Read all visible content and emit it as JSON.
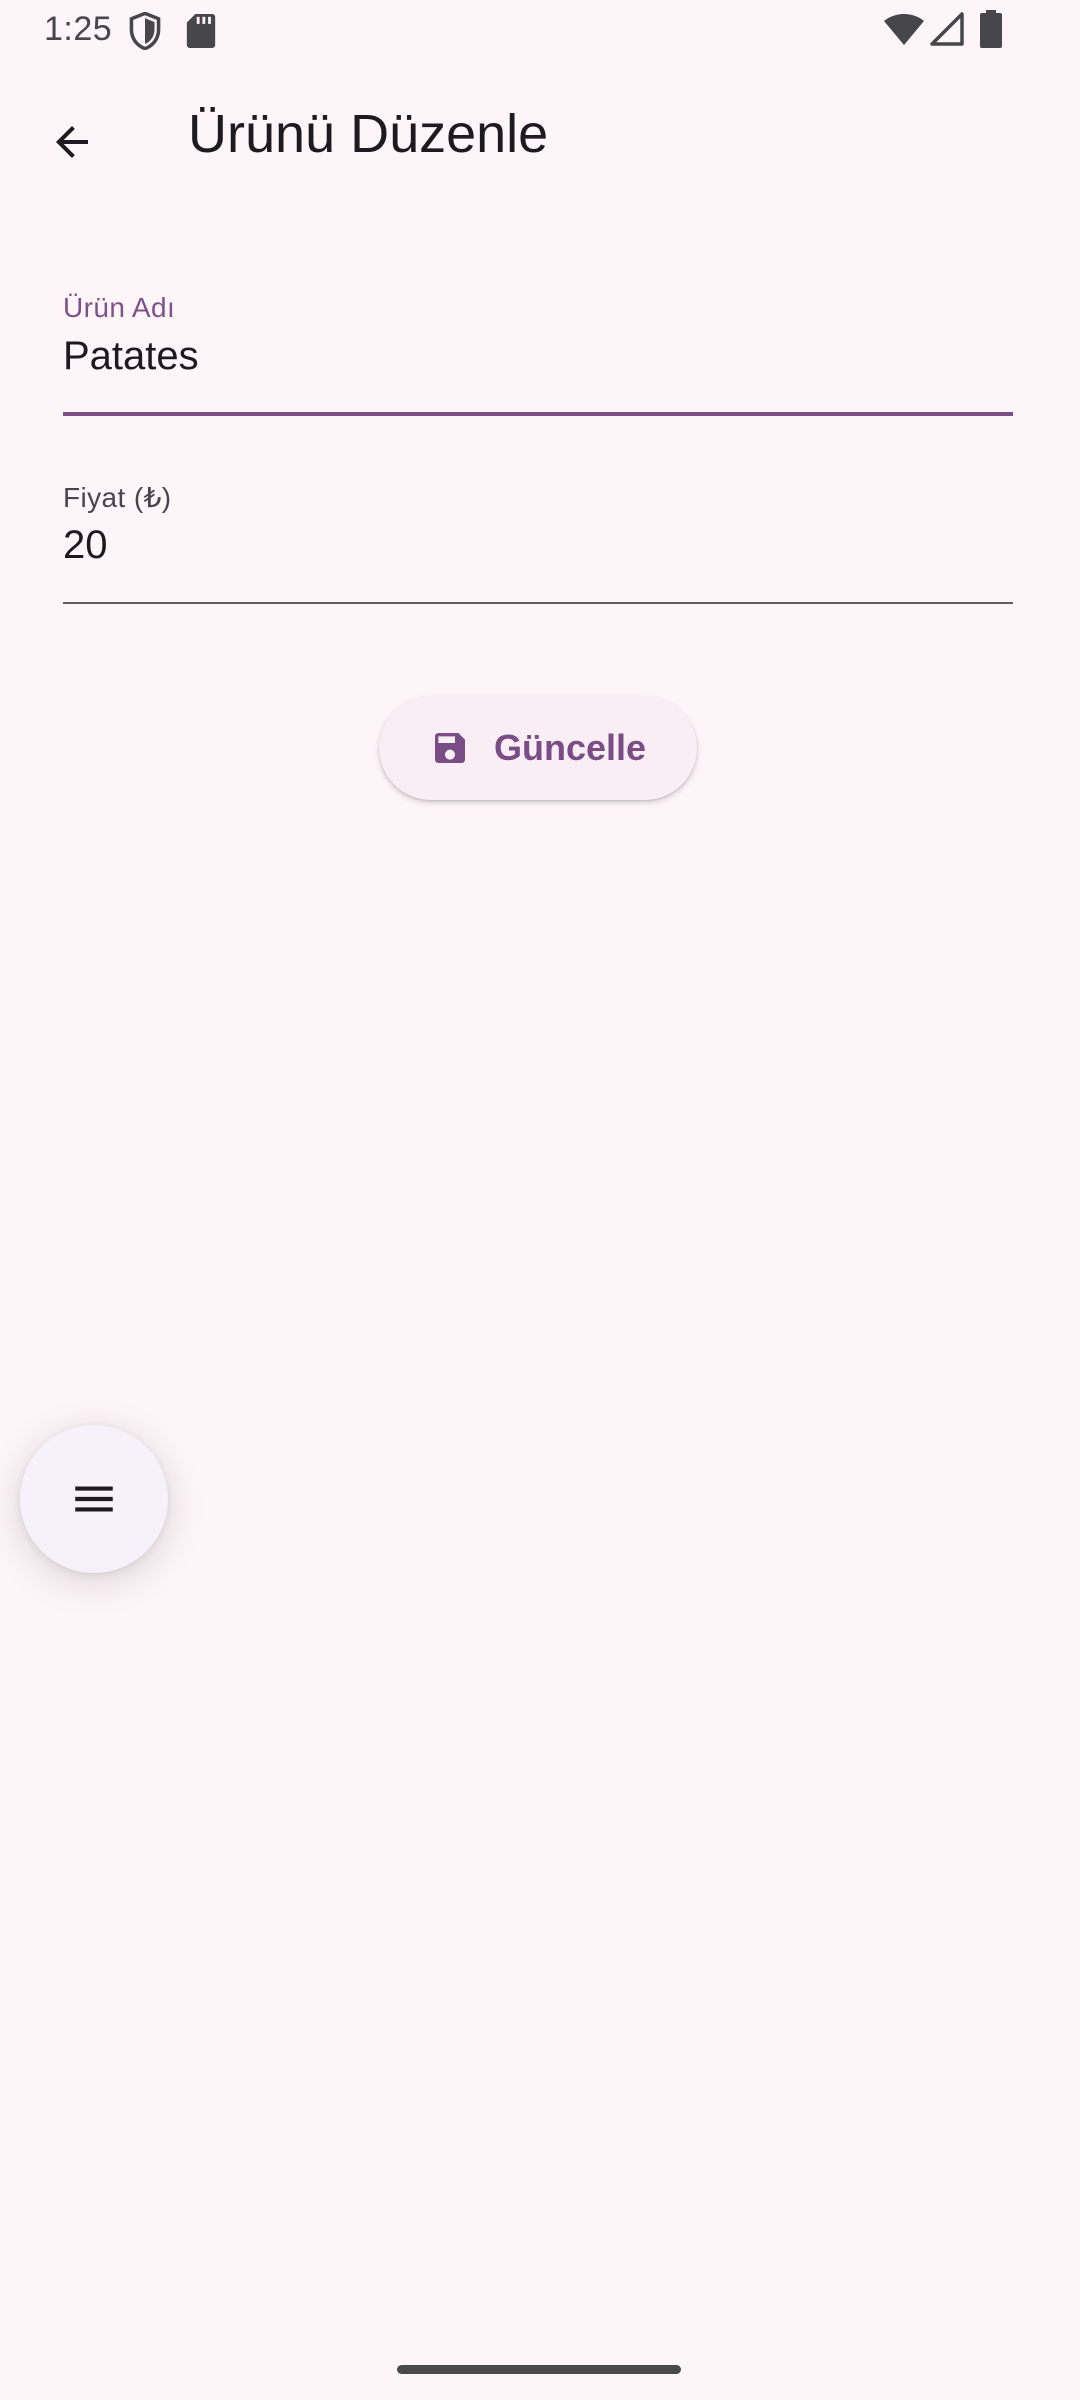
{
  "status_bar": {
    "time": "1:25",
    "left_icons": [
      "shield-icon",
      "sd-card-icon"
    ],
    "right_icons": [
      "wifi-icon",
      "cellular-signal-icon",
      "battery-icon"
    ]
  },
  "app_bar": {
    "back_icon": "arrow-back-icon",
    "title": "Ürünü Düzenle"
  },
  "form": {
    "product_name": {
      "label": "Ürün Adı",
      "value": "Patates",
      "focused": true
    },
    "price": {
      "label": "Fiyat (₺)",
      "value": "20",
      "focused": false
    }
  },
  "update_button": {
    "icon": "save-icon",
    "label": "Güncelle"
  },
  "fab": {
    "icon": "menu-icon"
  },
  "colors": {
    "background": "#fef5f8",
    "primary": "#7d4f88",
    "button_surface": "#f8eef4",
    "fab_surface": "#f6f1fa",
    "text": "#1d1b20"
  }
}
